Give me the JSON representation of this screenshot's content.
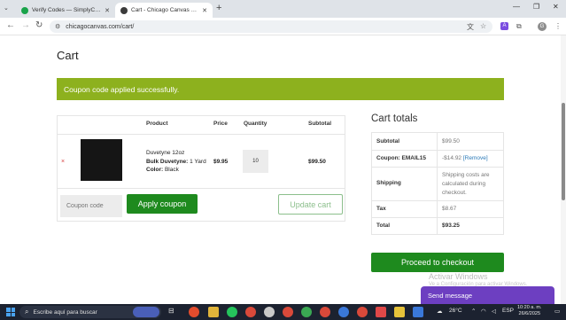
{
  "browser": {
    "tabs": [
      {
        "title": "Verify Codes — SimplyCodes",
        "active": false
      },
      {
        "title": "Cart - Chicago Canvas and Sup",
        "active": true
      }
    ],
    "url": "chicagocanvas.com/cart/"
  },
  "page": {
    "title": "Cart",
    "notice": "Coupon code applied successfully."
  },
  "cart": {
    "columns": {
      "product": "Product",
      "price": "Price",
      "quantity": "Quantity",
      "subtotal": "Subtotal"
    },
    "item": {
      "remove": "×",
      "name": "Duvetyne 12oz",
      "variation_label": "Bulk Duvetyne:",
      "variation_value": "1 Yard",
      "color_label": "Color:",
      "color_value": "Black",
      "price": "$9.95",
      "quantity": "10",
      "subtotal": "$99.50"
    },
    "coupon_placeholder": "Coupon code",
    "apply_label": "Apply coupon",
    "update_label": "Update cart"
  },
  "totals": {
    "title": "Cart totals",
    "subtotal_label": "Subtotal",
    "subtotal_value": "$99.50",
    "coupon_label": "Coupon: EMAIL15",
    "coupon_value": "-$14.92",
    "coupon_remove": "[Remove]",
    "shipping_label": "Shipping",
    "shipping_value": "Shipping costs are calculated during checkout.",
    "tax_label": "Tax",
    "tax_value": "$8.67",
    "total_label": "Total",
    "total_value": "$93.25",
    "checkout_label": "Proceed to checkout"
  },
  "overlay": {
    "activate": "Activar Windows",
    "activate_sub": "Ve a Configuración para activar Windows.",
    "send_message": "Send message"
  },
  "taskbar": {
    "search_placeholder": "Escribe aquí para buscar",
    "temperature": "26°C",
    "language": "ESP",
    "time": "10:20 a. m.",
    "date": "26/6/2025"
  },
  "colors": {
    "accent_green": "#1e8a1e",
    "notice_green": "#8db11e",
    "send_purple": "#6d3fc1"
  }
}
